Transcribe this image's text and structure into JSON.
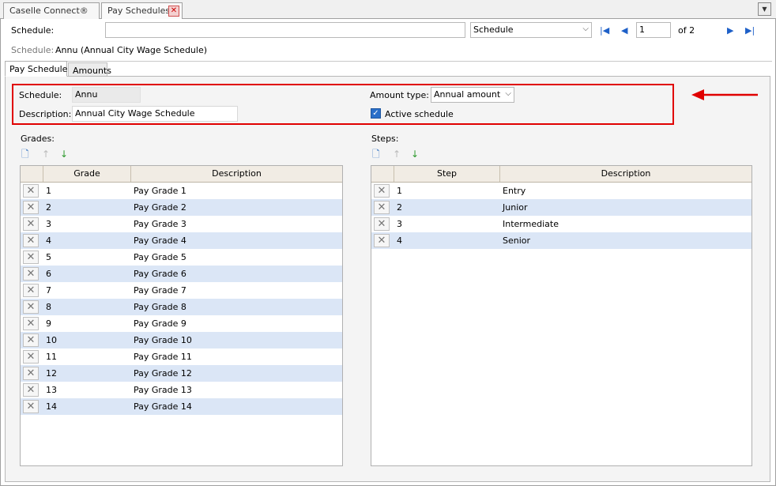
{
  "tabs": [
    {
      "label": "Caselle Connect®"
    },
    {
      "label": "Pay Schedules"
    }
  ],
  "toolbar": {
    "schedule_label": "Schedule:",
    "search_value": "",
    "search_type": "Schedule",
    "record_number": "1",
    "record_of": "of 2"
  },
  "record": {
    "label": "Schedule:",
    "value": "Annu (Annual City Wage Schedule)"
  },
  "subtabs": [
    {
      "label": "Pay Schedule"
    },
    {
      "label": "Amounts"
    }
  ],
  "form": {
    "schedule_label": "Schedule:",
    "schedule_value": "Annu",
    "description_label": "Description:",
    "description_value": "Annual City Wage Schedule",
    "amount_type_label": "Amount type:",
    "amount_type_value": "Annual amount",
    "active_label": "Active schedule",
    "active_checked": true
  },
  "grades": {
    "title": "Grades:",
    "columns": [
      "Grade",
      "Description"
    ],
    "rows": [
      {
        "grade": "1",
        "description": "Pay Grade 1"
      },
      {
        "grade": "2",
        "description": "Pay Grade 2"
      },
      {
        "grade": "3",
        "description": "Pay Grade 3"
      },
      {
        "grade": "4",
        "description": "Pay Grade 4"
      },
      {
        "grade": "5",
        "description": "Pay Grade 5"
      },
      {
        "grade": "6",
        "description": "Pay Grade 6"
      },
      {
        "grade": "7",
        "description": "Pay Grade 7"
      },
      {
        "grade": "8",
        "description": "Pay Grade 8"
      },
      {
        "grade": "9",
        "description": "Pay Grade 9"
      },
      {
        "grade": "10",
        "description": "Pay Grade 10"
      },
      {
        "grade": "11",
        "description": "Pay Grade 11"
      },
      {
        "grade": "12",
        "description": "Pay Grade 12"
      },
      {
        "grade": "13",
        "description": "Pay Grade 13"
      },
      {
        "grade": "14",
        "description": "Pay Grade 14"
      }
    ]
  },
  "steps": {
    "title": "Steps:",
    "columns": [
      "Step",
      "Description"
    ],
    "rows": [
      {
        "step": "1",
        "description": "Entry"
      },
      {
        "step": "2",
        "description": "Junior"
      },
      {
        "step": "3",
        "description": "Intermediate"
      },
      {
        "step": "4",
        "description": "Senior"
      }
    ]
  },
  "colors": {
    "highlight_border": "#e00000",
    "row_alt": "#dbe6f6",
    "checkbox": "#2a6fc9",
    "nav_icon": "#1e60c8"
  }
}
